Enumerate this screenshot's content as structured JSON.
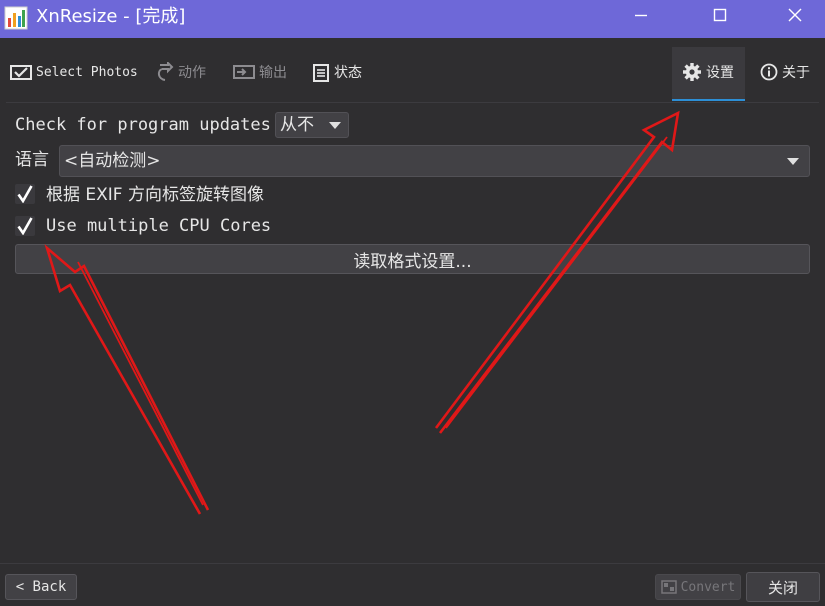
{
  "window": {
    "title": "XnResize - [完成]"
  },
  "toolbar": {
    "select_photos": "Select Photos",
    "action": "动作",
    "output": "输出",
    "status": "状态",
    "settings": "设置",
    "about": "关于"
  },
  "settings": {
    "updates_label": "Check for program updates",
    "updates_value": "从不",
    "language_label": "语言",
    "language_value": "<自动检测>",
    "exif_rotate_label": "根据 EXIF 方向标签旋转图像",
    "exif_rotate_checked": true,
    "multi_cpu_label": "Use multiple CPU Cores",
    "multi_cpu_checked": true,
    "read_format_button": "读取格式设置..."
  },
  "footer": {
    "back_label": "< Back",
    "convert_label": "Convert",
    "close_label": "关闭"
  },
  "colors": {
    "titlebar": "#6e68d8",
    "background": "#2f2e30",
    "accent_underline": "#2d8fd6",
    "annotation_arrow": "#e01818"
  }
}
